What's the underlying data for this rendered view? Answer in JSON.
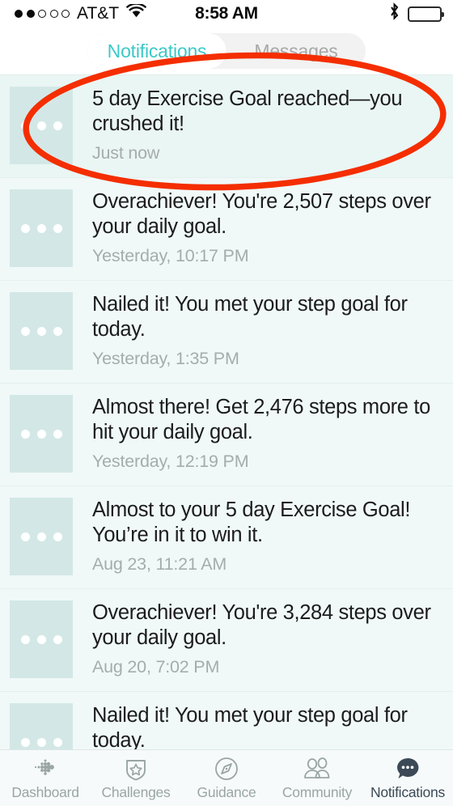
{
  "status_bar": {
    "signal_dots_filled": 2,
    "signal_dots_total": 5,
    "carrier": "AT&T",
    "wifi_icon": "wifi-icon",
    "time": "8:58 AM",
    "bluetooth_icon": "bluetooth-icon",
    "battery_icon": "battery-full-icon",
    "battery_level_percent": 100
  },
  "segmented_control": {
    "tabs": [
      {
        "label": "Notifications",
        "active": true
      },
      {
        "label": "Messages",
        "active": false
      }
    ],
    "active_color": "#3cc8c8",
    "inactive_color": "#a8a8a8"
  },
  "annotation": {
    "shape": "ellipse",
    "color": "#f42e00",
    "target": "first-notification-row"
  },
  "notifications": [
    {
      "title": "5 day Exercise Goal reached—you crushed it!",
      "time": "Just now",
      "highlighted": true,
      "thumbnail": "placeholder-image"
    },
    {
      "title": "Overachiever! You're 2,507 steps over your daily goal.",
      "time": "Yesterday, 10:17 PM",
      "highlighted": false,
      "thumbnail": "placeholder-image"
    },
    {
      "title": "Nailed it! You met your step goal for today.",
      "time": "Yesterday, 1:35 PM",
      "highlighted": false,
      "thumbnail": "placeholder-image"
    },
    {
      "title": "Almost there! Get 2,476 steps more to hit your daily goal.",
      "time": "Yesterday, 12:19 PM",
      "highlighted": false,
      "thumbnail": "placeholder-image"
    },
    {
      "title": "Almost to your 5 day Exercise Goal! You’re in it to win it.",
      "time": "Aug 23, 11:21 AM",
      "highlighted": false,
      "thumbnail": "placeholder-image"
    },
    {
      "title": "Overachiever! You're 3,284 steps over your daily goal.",
      "time": "Aug 20, 7:02 PM",
      "highlighted": false,
      "thumbnail": "placeholder-image"
    },
    {
      "title": "Nailed it! You met your step goal for today.",
      "time": "",
      "highlighted": false,
      "thumbnail": "placeholder-image"
    }
  ],
  "tabbar": {
    "items": [
      {
        "label": "Dashboard",
        "icon": "dashboard-dots-icon",
        "active": false
      },
      {
        "label": "Challenges",
        "icon": "shield-star-icon",
        "active": false
      },
      {
        "label": "Guidance",
        "icon": "compass-icon",
        "active": false
      },
      {
        "label": "Community",
        "icon": "people-icon",
        "active": false
      },
      {
        "label": "Notifications",
        "icon": "chat-bubble-dots-icon",
        "active": true
      }
    ]
  }
}
